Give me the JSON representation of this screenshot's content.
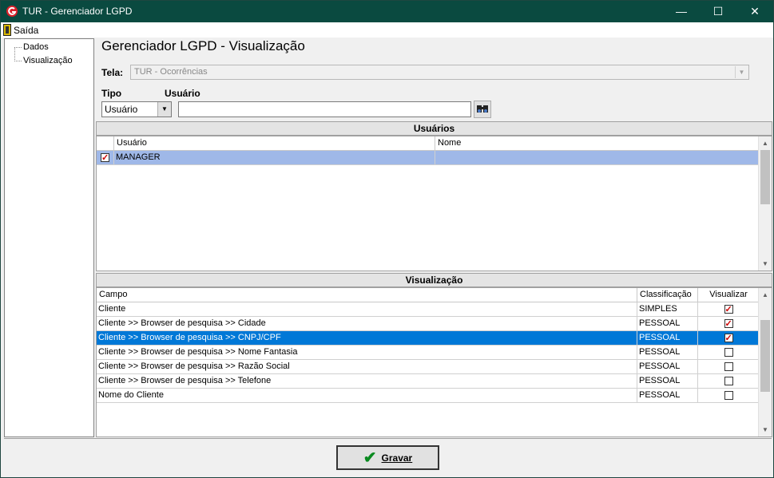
{
  "window": {
    "title": "TUR - Gerenciador LGPD",
    "minimize": "—",
    "maximize": "☐",
    "close": "✕"
  },
  "menu": {
    "exit_label": "Saída"
  },
  "tree": {
    "items": [
      {
        "label": "Dados"
      },
      {
        "label": "Visualização"
      }
    ]
  },
  "page": {
    "heading": "Gerenciador LGPD - Visualização"
  },
  "form": {
    "tela_label": "Tela:",
    "tela_value": "TUR - Ocorrências",
    "tipo_label": "Tipo",
    "tipo_value": "Usuário",
    "usuario_label": "Usuário",
    "usuario_value": ""
  },
  "users_section": {
    "title": "Usuários",
    "columns": [
      "Usuário",
      "Nome"
    ],
    "rows": [
      {
        "checked": true,
        "usuario": "MANAGER",
        "nome": ""
      }
    ]
  },
  "view_section": {
    "title": "Visualização",
    "columns": [
      "Campo",
      "Classificação",
      "Visualizar"
    ],
    "rows": [
      {
        "campo": "Cliente",
        "classificacao": "SIMPLES",
        "visualizar": true
      },
      {
        "campo": "Cliente >> Browser de pesquisa >> Cidade",
        "classificacao": "PESSOAL",
        "visualizar": true
      },
      {
        "campo": "Cliente >> Browser de pesquisa >> CNPJ/CPF",
        "classificacao": "PESSOAL",
        "visualizar": true
      },
      {
        "campo": "Cliente >> Browser de pesquisa >> Nome Fantasia",
        "classificacao": "PESSOAL",
        "visualizar": false
      },
      {
        "campo": "Cliente >> Browser de pesquisa >> Razão Social",
        "classificacao": "PESSOAL",
        "visualizar": false
      },
      {
        "campo": "Cliente >> Browser de pesquisa >> Telefone",
        "classificacao": "PESSOAL",
        "visualizar": false
      },
      {
        "campo": "Nome do Cliente",
        "classificacao": "PESSOAL",
        "visualizar": false
      }
    ]
  },
  "actions": {
    "save_label": "Gravar"
  },
  "colors": {
    "titlebar": "#0a4a40",
    "selected_user_row": "#9fb8e8",
    "selected_view_row": "#0078d7",
    "check_mark": "#cc0000",
    "save_icon": "#0a8a20"
  }
}
